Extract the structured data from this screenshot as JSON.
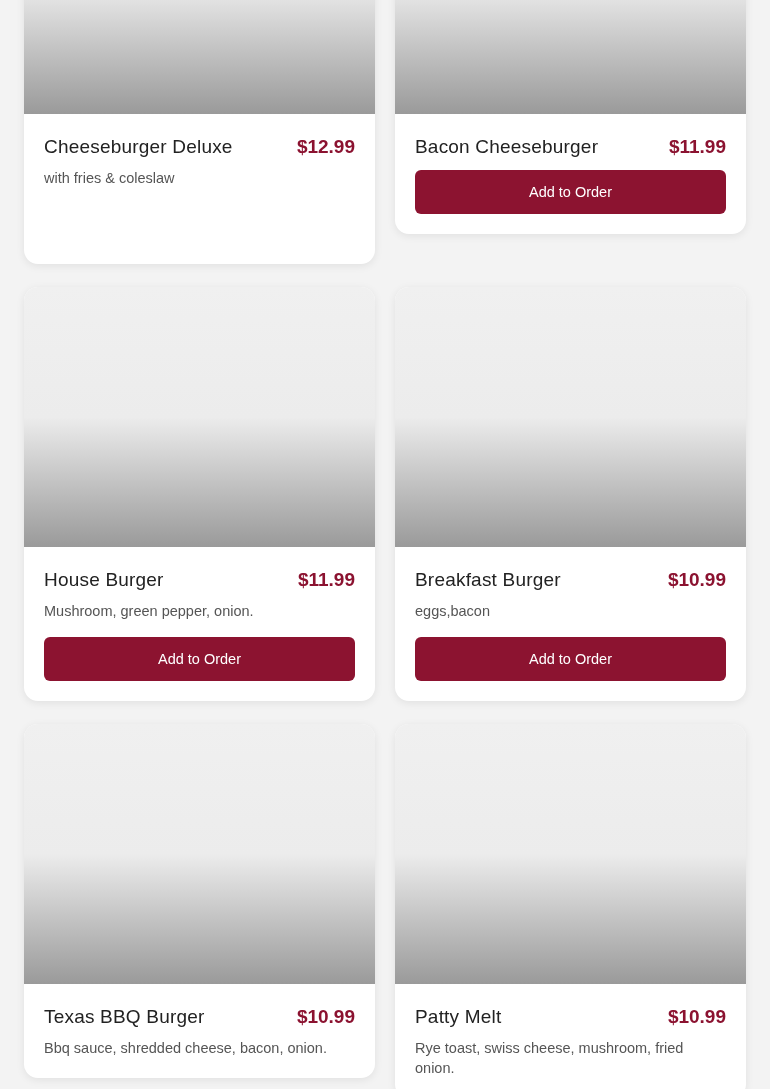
{
  "items": [
    {
      "name": "Cheeseburger Deluxe",
      "price": "$12.99",
      "description": "with fries & coleslaw"
    },
    {
      "name": "Bacon Cheeseburger",
      "price": "$11.99",
      "button": "Add to Order"
    },
    {
      "name": "House Burger",
      "price": "$11.99",
      "description": "Mushroom, green pepper, onion.",
      "button": "Add to Order"
    },
    {
      "name": "Breakfast Burger",
      "price": "$10.99",
      "description": "eggs,bacon",
      "button": "Add to Order"
    },
    {
      "name": "Texas BBQ Burger",
      "price": "$10.99",
      "description": "Bbq sauce, shredded cheese, bacon, onion."
    },
    {
      "name": "Patty Melt",
      "price": "$10.99",
      "description": "Rye toast, swiss cheese, mushroom, fried onion."
    }
  ]
}
